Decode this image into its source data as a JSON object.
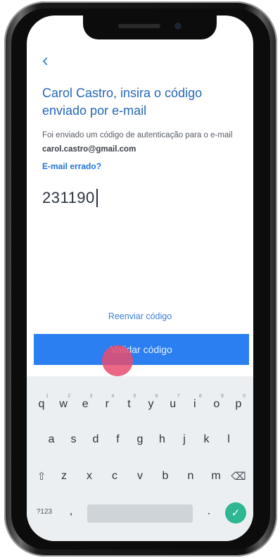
{
  "header": {
    "back_icon": "chevron-left-icon",
    "back_glyph": "‹"
  },
  "title": "Carol Castro, insira o código enviado por e-mail",
  "description": {
    "prefix": "Foi enviado um código de autenticação para o e-mail",
    "email": "carol.castro@gmail.com"
  },
  "wrong_email_link": "E-mail errado?",
  "code_input": {
    "value": "231190"
  },
  "resend_link": "Reenviar código",
  "validate_button": "Validar código",
  "keyboard": {
    "row1": [
      {
        "k": "q",
        "n": "1"
      },
      {
        "k": "w",
        "n": "2"
      },
      {
        "k": "e",
        "n": "3"
      },
      {
        "k": "r",
        "n": "4"
      },
      {
        "k": "t",
        "n": "5"
      },
      {
        "k": "y",
        "n": "6"
      },
      {
        "k": "u",
        "n": "7"
      },
      {
        "k": "i",
        "n": "8"
      },
      {
        "k": "o",
        "n": "9"
      },
      {
        "k": "p",
        "n": "0"
      }
    ],
    "row2": [
      "a",
      "s",
      "d",
      "f",
      "g",
      "h",
      "j",
      "k",
      "l"
    ],
    "row3": [
      "z",
      "x",
      "c",
      "v",
      "b",
      "n",
      "m"
    ],
    "shift_glyph": "⇧",
    "backspace_glyph": "⌫",
    "symbols_label": "?123",
    "comma": ",",
    "period": ".",
    "enter_glyph": "✓"
  },
  "colors": {
    "accent": "#2b7ff1",
    "title": "#2668b8",
    "enter_key": "#2fb692",
    "touch_indicator": "#e84c6e"
  }
}
